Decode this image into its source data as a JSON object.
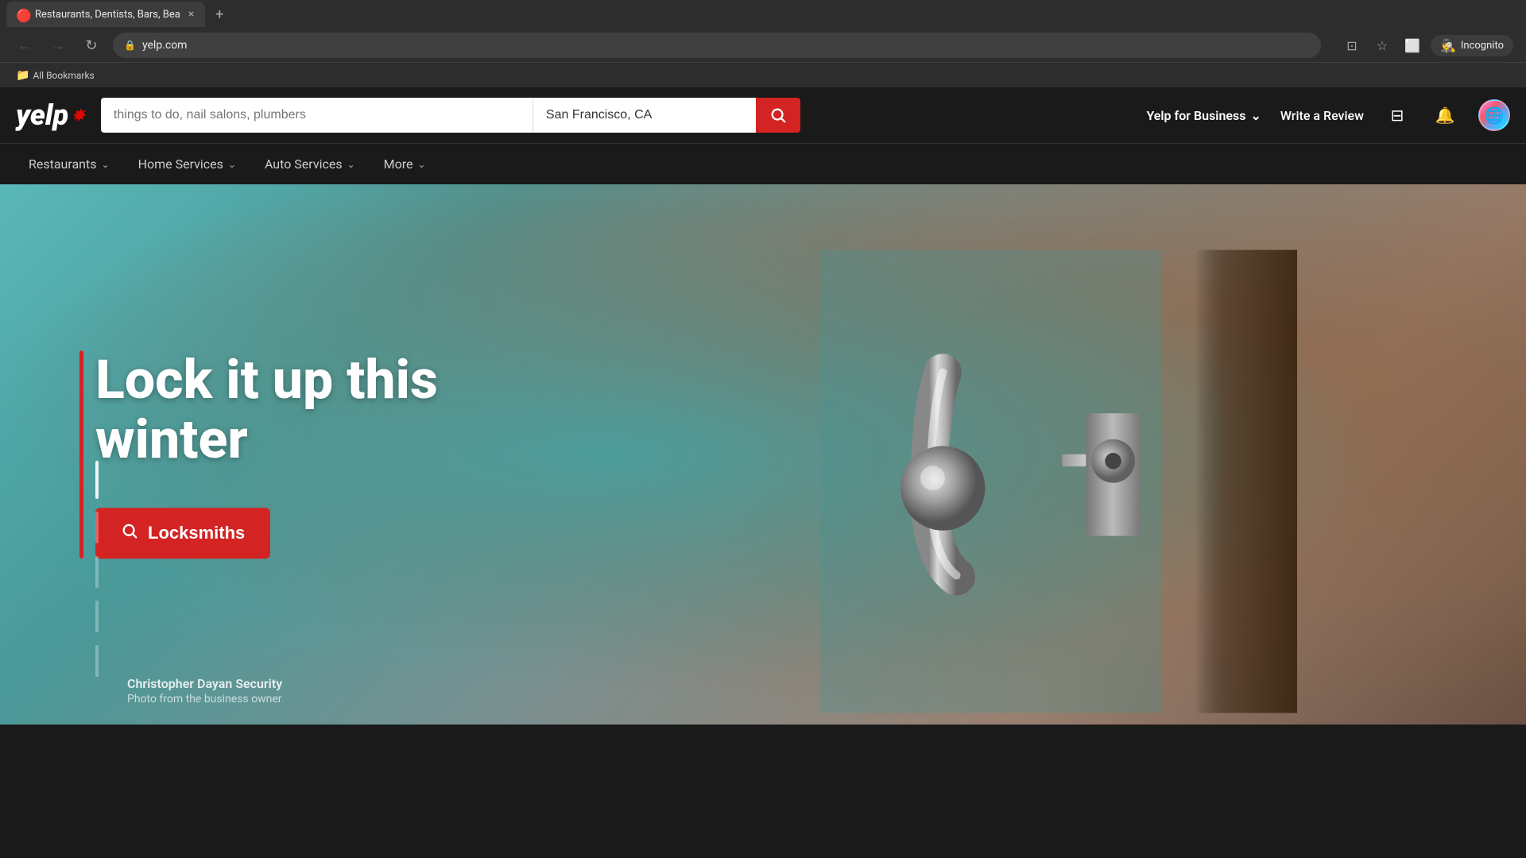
{
  "browser": {
    "tab": {
      "favicon": "🔴",
      "title": "Restaurants, Dentists, Bars, Bea",
      "close_label": "×"
    },
    "new_tab_label": "+",
    "url": "yelp.com",
    "incognito_label": "Incognito",
    "bookmarks_bar_label": "All Bookmarks",
    "bookmarks_folder_icon": "📁"
  },
  "header": {
    "logo_text": "yelp",
    "search_placeholder": "things to do, nail salons, plumbers",
    "location_value": "San Francisco, CA",
    "search_btn_label": "Search",
    "yelp_for_business_label": "Yelp for Business",
    "write_review_label": "Write a Review"
  },
  "nav": {
    "items": [
      {
        "label": "Restaurants",
        "has_chevron": true
      },
      {
        "label": "Home Services",
        "has_chevron": true
      },
      {
        "label": "Auto Services",
        "has_chevron": true
      },
      {
        "label": "More",
        "has_chevron": true
      }
    ]
  },
  "hero": {
    "title_line1": "Lock it up this",
    "title_line2": "winter",
    "cta_label": "Locksmiths",
    "photo_credit_name": "Christopher Dayan Security",
    "photo_credit_sub": "Photo from the business owner"
  }
}
